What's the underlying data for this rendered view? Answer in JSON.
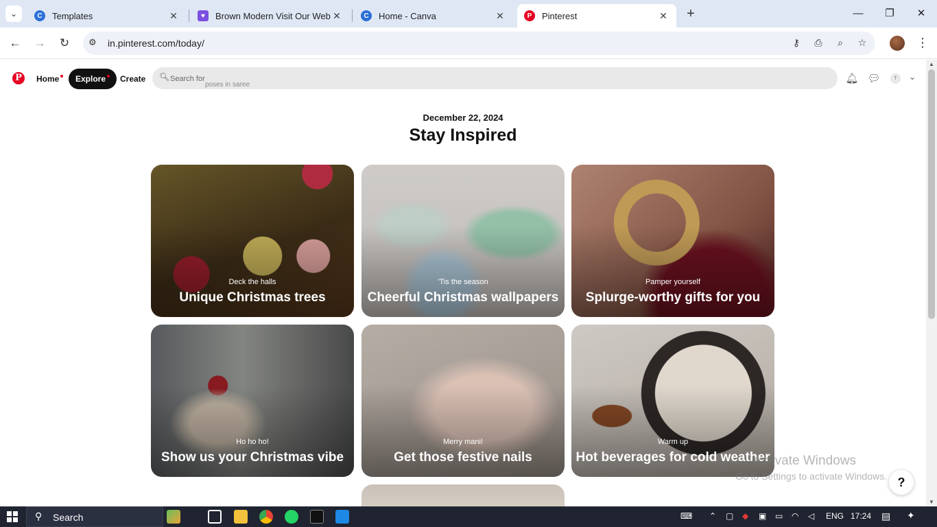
{
  "browser": {
    "tabs": [
      {
        "title": "Templates",
        "favicon_color": "#2b6fd6",
        "favicon_glyph": "C",
        "active": false
      },
      {
        "title": "Brown Modern Visit Our Websit",
        "favicon_color": "#7b4fe0",
        "favicon_glyph": "♥",
        "active": false
      },
      {
        "title": "Home - Canva",
        "favicon_color": "#2b6fd6",
        "favicon_glyph": "C",
        "active": false
      },
      {
        "title": "Pinterest",
        "favicon_color": "#e60023",
        "favicon_glyph": "P",
        "active": true
      }
    ],
    "url": "in.pinterest.com/today/"
  },
  "pinterest": {
    "logo_glyph": "P",
    "nav": {
      "home": "Home",
      "explore": "Explore",
      "create": "Create"
    },
    "search": {
      "placeholder": "Search for",
      "suggestion": "poses in saree"
    },
    "avatar_initial": "T"
  },
  "today": {
    "date": "December 22, 2024",
    "heading": "Stay Inspired",
    "cards": [
      {
        "subtitle": "Deck the halls",
        "title": "Unique Christmas trees"
      },
      {
        "subtitle": "'Tis the season",
        "title": "Cheerful Christmas wallpapers"
      },
      {
        "subtitle": "Pamper yourself",
        "title": "Splurge-worthy gifts for you"
      },
      {
        "subtitle": "Ho ho ho!",
        "title": "Show us your Christmas vibe"
      },
      {
        "subtitle": "Merry mani!",
        "title": "Get those festive nails"
      },
      {
        "subtitle": "Warm up",
        "title": "Hot beverages for cold weather"
      }
    ]
  },
  "watermark": {
    "line1": "Activate Windows",
    "line2": "Go to Settings to activate Windows."
  },
  "help_label": "?",
  "taskbar": {
    "search_label": "Search",
    "language": "ENG",
    "time": "17:24"
  },
  "colors": {
    "pinterest_red": "#e60023",
    "taskbar_bg": "#1f2430"
  }
}
